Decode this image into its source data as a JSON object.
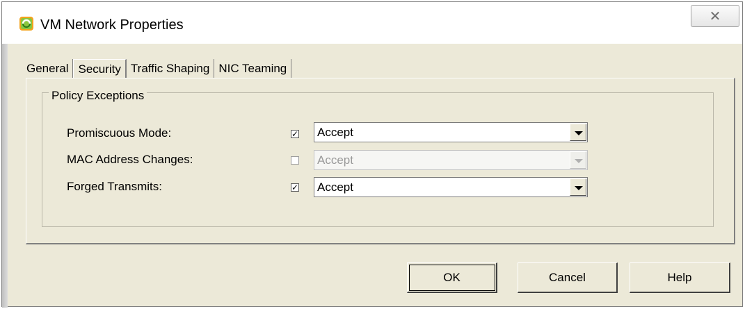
{
  "window": {
    "title": "VM Network Properties",
    "icon": "vsphere-app-icon",
    "close_icon": "close-icon",
    "accent": "#f5a623"
  },
  "tabs": [
    {
      "label": "General",
      "active": false
    },
    {
      "label": "Security",
      "active": true
    },
    {
      "label": "Traffic Shaping",
      "active": false
    },
    {
      "label": "NIC Teaming",
      "active": false
    }
  ],
  "group": {
    "title": "Policy Exceptions",
    "rows": [
      {
        "label": "Promiscuous Mode:",
        "checked": true,
        "check_mark": "✓",
        "value": "Accept",
        "enabled": true
      },
      {
        "label": "MAC Address Changes:",
        "checked": false,
        "check_mark": "",
        "value": "Accept",
        "enabled": false
      },
      {
        "label": "Forged Transmits:",
        "checked": true,
        "check_mark": "✓",
        "value": "Accept",
        "enabled": true
      }
    ]
  },
  "buttons": {
    "ok": "OK",
    "cancel": "Cancel",
    "help": "Help"
  }
}
